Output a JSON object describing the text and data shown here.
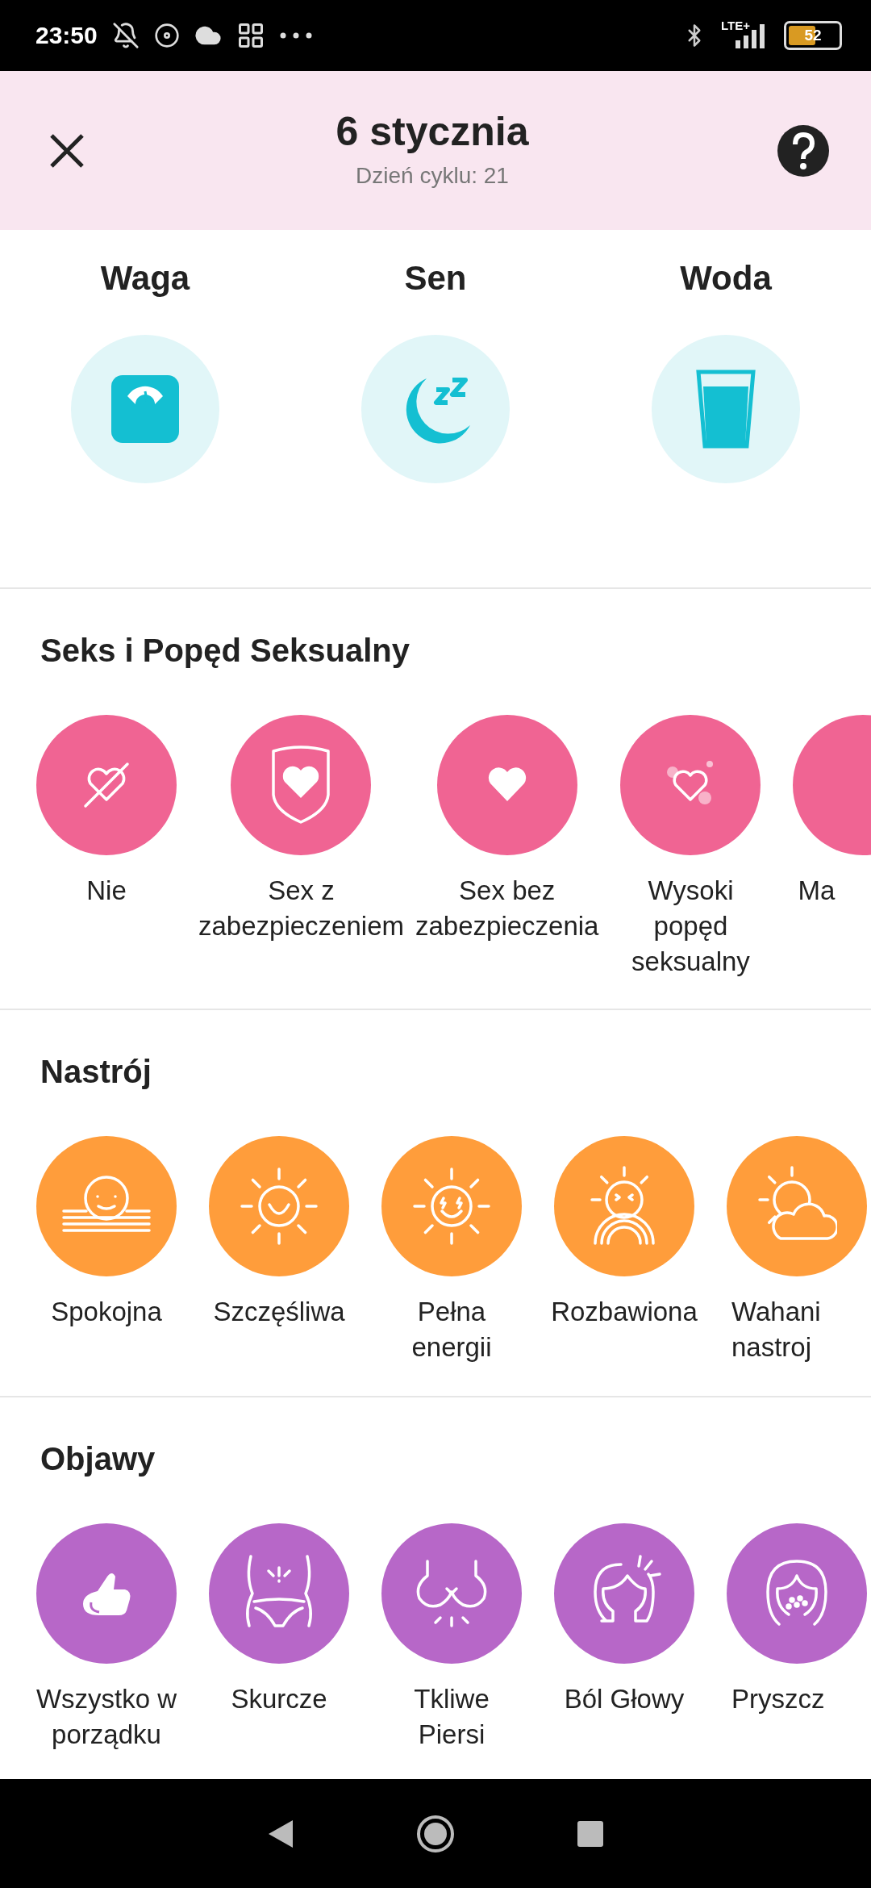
{
  "status_bar": {
    "time": "23:50",
    "network": "LTE+",
    "battery": "52"
  },
  "header": {
    "title": "6 stycznia",
    "subtitle": "Dzień cyklu: 21"
  },
  "trackers": [
    {
      "label": "Waga"
    },
    {
      "label": "Sen"
    },
    {
      "label": "Woda"
    }
  ],
  "sections": [
    {
      "title": "Seks i Popęd Seksualny",
      "color": "#f06493",
      "items": [
        {
          "label": "Nie",
          "cut": false
        },
        {
          "label": "Sex z\nzabezpieczeniem",
          "cut": false
        },
        {
          "label": "Sex bez\nzabezpieczenia",
          "cut": false
        },
        {
          "label": "Wysoki\npopęd\nseksualny",
          "cut": false
        },
        {
          "label": "Ma",
          "cut": true
        }
      ]
    },
    {
      "title": "Nastrój",
      "color": "#ff9d3b",
      "items": [
        {
          "label": "Spokojna",
          "cut": false
        },
        {
          "label": "Szczęśliwa",
          "cut": false
        },
        {
          "label": "Pełna\nenergii",
          "cut": false
        },
        {
          "label": "Rozbawiona",
          "cut": false
        },
        {
          "label": "Wahani\nnastroj",
          "cut": true
        }
      ]
    },
    {
      "title": "Objawy",
      "color": "#b767c8",
      "items": [
        {
          "label": "Wszystko w\nporządku",
          "cut": false
        },
        {
          "label": "Skurcze",
          "cut": false
        },
        {
          "label": "Tkliwe\nPiersi",
          "cut": false
        },
        {
          "label": "Ból Głowy",
          "cut": false
        },
        {
          "label": "Pryszcz",
          "cut": true
        }
      ]
    }
  ]
}
